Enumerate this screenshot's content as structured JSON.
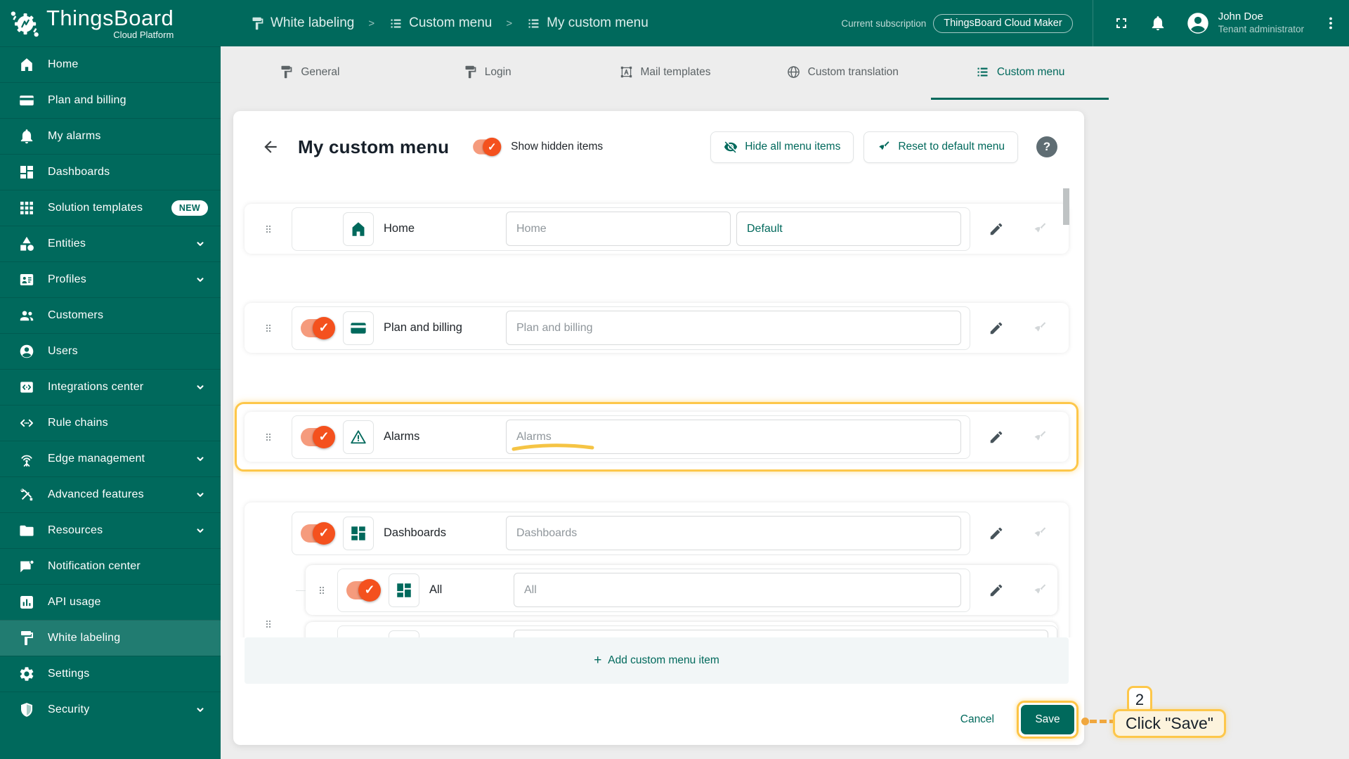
{
  "colors": {
    "primary_teal": "#00695c",
    "toggle_orange": "#f4511e",
    "annotation_gold": "#fdc74a",
    "connector_orange": "#f0a73e"
  },
  "header": {
    "logo_title": "ThingsBoard",
    "logo_subtitle": "Cloud Platform",
    "breadcrumb_separator": ">",
    "breadcrumbs": [
      {
        "label": "White labeling",
        "icon": "paint-roller-icon"
      },
      {
        "label": "Custom menu",
        "icon": "list-icon"
      },
      {
        "label": "My custom menu",
        "icon": "list-icon"
      }
    ],
    "subscription": {
      "label": "Current subscription",
      "plan": "ThingsBoard Cloud Maker"
    },
    "user": {
      "name": "John Doe",
      "role": "Tenant administrator"
    }
  },
  "sidebar": {
    "badge_new": "NEW",
    "items": [
      {
        "label": "Home",
        "icon": "home-icon"
      },
      {
        "label": "Plan and billing",
        "icon": "credit-card-icon"
      },
      {
        "label": "My alarms",
        "icon": "bell-icon"
      },
      {
        "label": "Dashboards",
        "icon": "dashboards-icon"
      },
      {
        "label": "Solution templates",
        "icon": "grid-icon",
        "badge": "NEW"
      },
      {
        "label": "Entities",
        "icon": "category-icon",
        "expandable": true
      },
      {
        "label": "Profiles",
        "icon": "badge-icon",
        "expandable": true
      },
      {
        "label": "Customers",
        "icon": "people-icon"
      },
      {
        "label": "Users",
        "icon": "person-icon"
      },
      {
        "label": "Integrations center",
        "icon": "integration-icon",
        "expandable": true
      },
      {
        "label": "Rule chains",
        "icon": "rule-chain-icon"
      },
      {
        "label": "Edge management",
        "icon": "antenna-icon",
        "expandable": true
      },
      {
        "label": "Advanced features",
        "icon": "tools-icon",
        "expandable": true
      },
      {
        "label": "Resources",
        "icon": "folder-icon",
        "expandable": true
      },
      {
        "label": "Notification center",
        "icon": "notification-icon"
      },
      {
        "label": "API usage",
        "icon": "bar-chart-icon"
      },
      {
        "label": "White labeling",
        "icon": "paint-roller-icon",
        "active": true
      },
      {
        "label": "Settings",
        "icon": "gear-icon"
      },
      {
        "label": "Security",
        "icon": "shield-icon",
        "expandable": true
      }
    ]
  },
  "tabs": [
    {
      "label": "General",
      "icon": "paint-roller-icon"
    },
    {
      "label": "Login",
      "icon": "paint-roller-icon"
    },
    {
      "label": "Mail templates",
      "icon": "text-frame-icon"
    },
    {
      "label": "Custom translation",
      "icon": "globe-icon"
    },
    {
      "label": "Custom menu",
      "icon": "list-icon",
      "active": true
    }
  ],
  "content": {
    "title": "My custom menu",
    "show_hidden_label": "Show hidden items",
    "hide_all_button": "Hide all menu items",
    "reset_button": "Reset to default menu",
    "help_glyph": "?",
    "rows": [
      {
        "label": "Home",
        "icon": "home-icon",
        "toggle": null,
        "inputs": {
          "name": "Home",
          "path": "Default"
        }
      },
      {
        "label": "Plan and billing",
        "icon": "credit-card-icon",
        "toggle": "on",
        "inputs": {
          "name": "Plan and billing"
        }
      },
      {
        "label": "Alarms",
        "icon": "warning-icon",
        "toggle": "on",
        "highlighted": true,
        "inputs": {
          "name": "Alarms"
        }
      },
      {
        "label": "Dashboards",
        "icon": "dashboards-icon",
        "toggle": "on",
        "group": true,
        "inputs": {
          "name": "Dashboards"
        },
        "children": [
          {
            "label": "All",
            "icon": "dashboards-icon",
            "toggle": "on",
            "inputs": {
              "name": "All"
            }
          }
        ]
      }
    ],
    "add_button_plus": "+",
    "add_button_label": "Add custom menu item",
    "cancel_button": "Cancel",
    "save_button": "Save"
  },
  "annotation": {
    "step": "2",
    "label": "Click \"Save\""
  }
}
